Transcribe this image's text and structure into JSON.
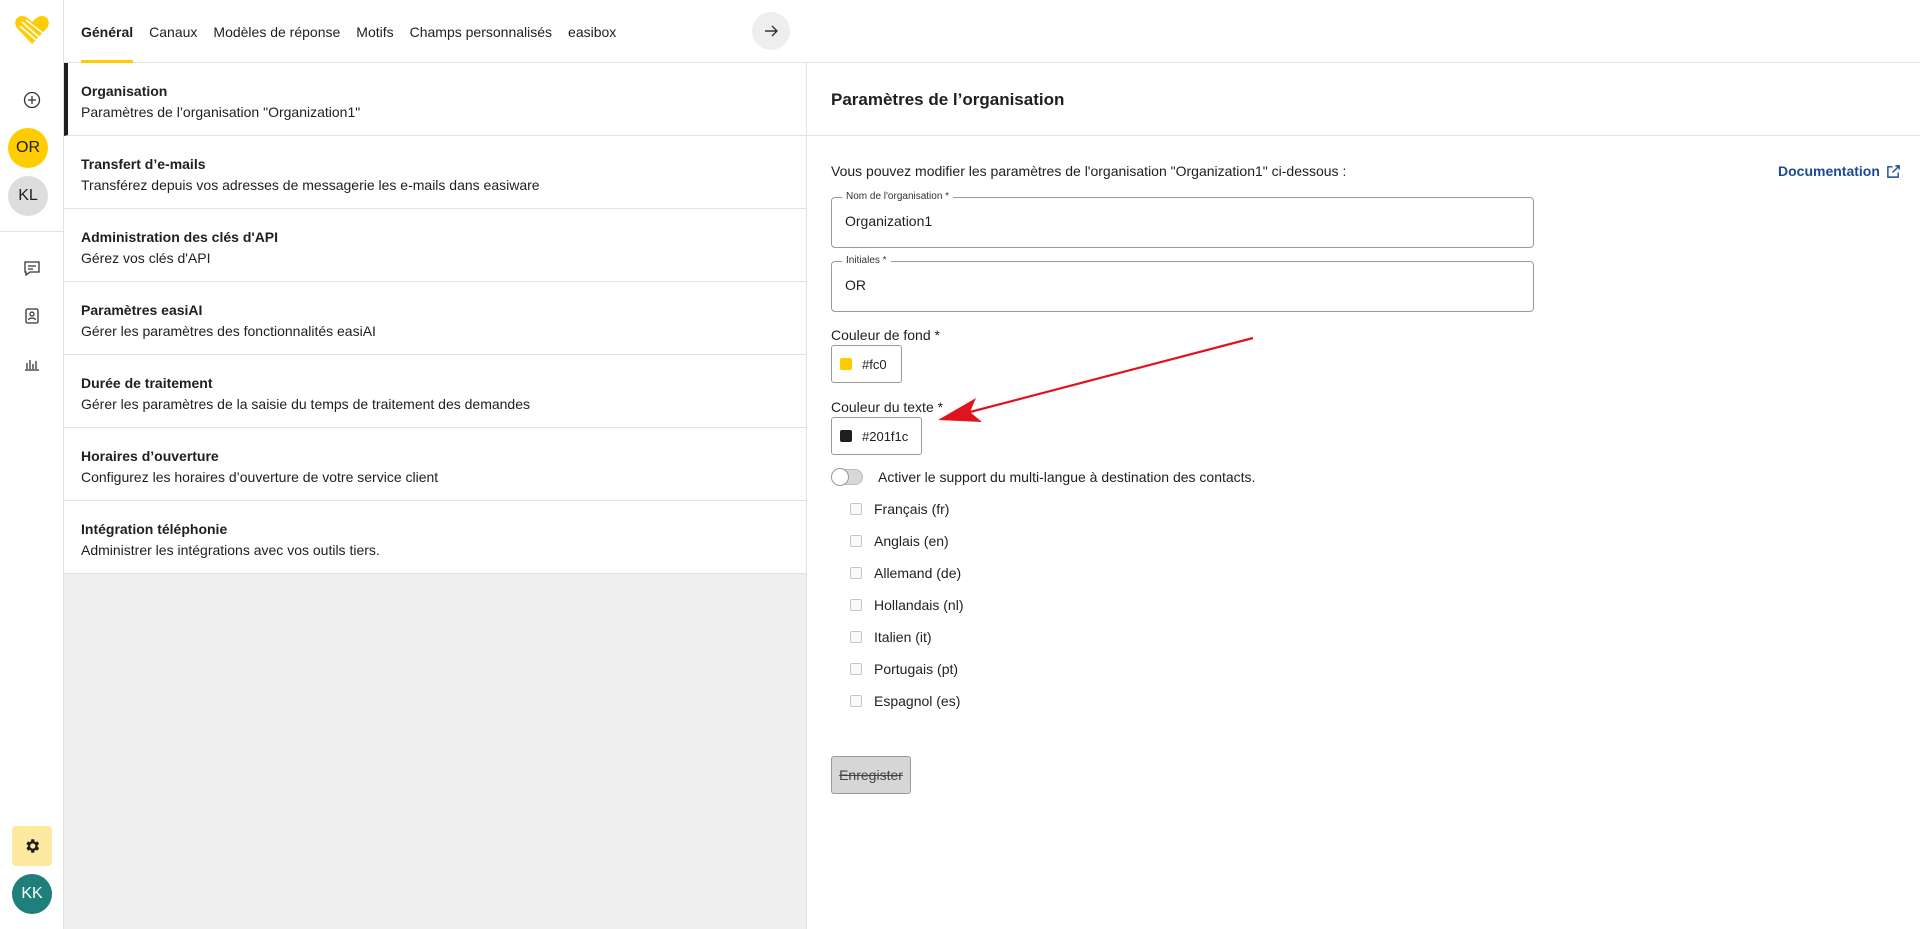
{
  "rail": {
    "avatars": [
      {
        "initials": "OR",
        "bg": "#ffcc00",
        "fg": "#201f1c"
      },
      {
        "initials": "KL",
        "bg": "#dddddd",
        "fg": "#201f1c"
      }
    ],
    "user_avatar": {
      "initials": "KK",
      "bg": "#1f7f7a",
      "fg": "#ffffff"
    }
  },
  "tabs": [
    {
      "label": "Général",
      "active": true
    },
    {
      "label": "Canaux"
    },
    {
      "label": "Modèles de réponse"
    },
    {
      "label": "Motifs"
    },
    {
      "label": "Champs personnalisés"
    },
    {
      "label": "easibox"
    }
  ],
  "settings_list": [
    {
      "title": "Organisation",
      "desc": "Paramètres de l’organisation \"Organization1\""
    },
    {
      "title": "Transfert d’e-mails",
      "desc": "Transférez depuis vos adresses de messagerie les e-mails dans easiware"
    },
    {
      "title": "Administration des clés d'API",
      "desc": "Gérez vos clés d'API"
    },
    {
      "title": "Paramètres easiAI",
      "desc": "Gérer les paramètres des fonctionnalités easiAI"
    },
    {
      "title": "Durée de traitement",
      "desc": "Gérer les paramètres de la saisie du temps de traitement des demandes"
    },
    {
      "title": "Horaires d’ouverture",
      "desc": "Configurez les horaires d’ouverture de votre service client"
    },
    {
      "title": "Intégration téléphonie",
      "desc": "Administrer les intégrations avec vos outils tiers."
    }
  ],
  "content": {
    "title": "Paramètres de l’organisation",
    "intro": "Vous pouvez modifier les paramètres de l'organisation \"Organization1\" ci-dessous :",
    "doc_link": "Documentation",
    "org_name": {
      "label": "Nom de l'organisation *",
      "value": "Organization1"
    },
    "initials": {
      "label": "Initiales *",
      "value": "OR"
    },
    "bg_color": {
      "label": "Couleur de fond *",
      "value": "#fc0",
      "swatch": "#ffcc00"
    },
    "text_color": {
      "label": "Couleur du texte *",
      "value": "#201f1c",
      "swatch": "#201f1c"
    },
    "multilang_label": "Activer le support du multi-langue à destination des contacts.",
    "languages": [
      "Français (fr)",
      "Anglais (en)",
      "Allemand (de)",
      "Hollandais (nl)",
      "Italien (it)",
      "Portugais (pt)",
      "Espagnol (es)"
    ],
    "save_label": "Enregister"
  },
  "colors": {
    "accent": "#ffcc00",
    "annotation": "#e0141e",
    "link": "#1a4a8f"
  }
}
